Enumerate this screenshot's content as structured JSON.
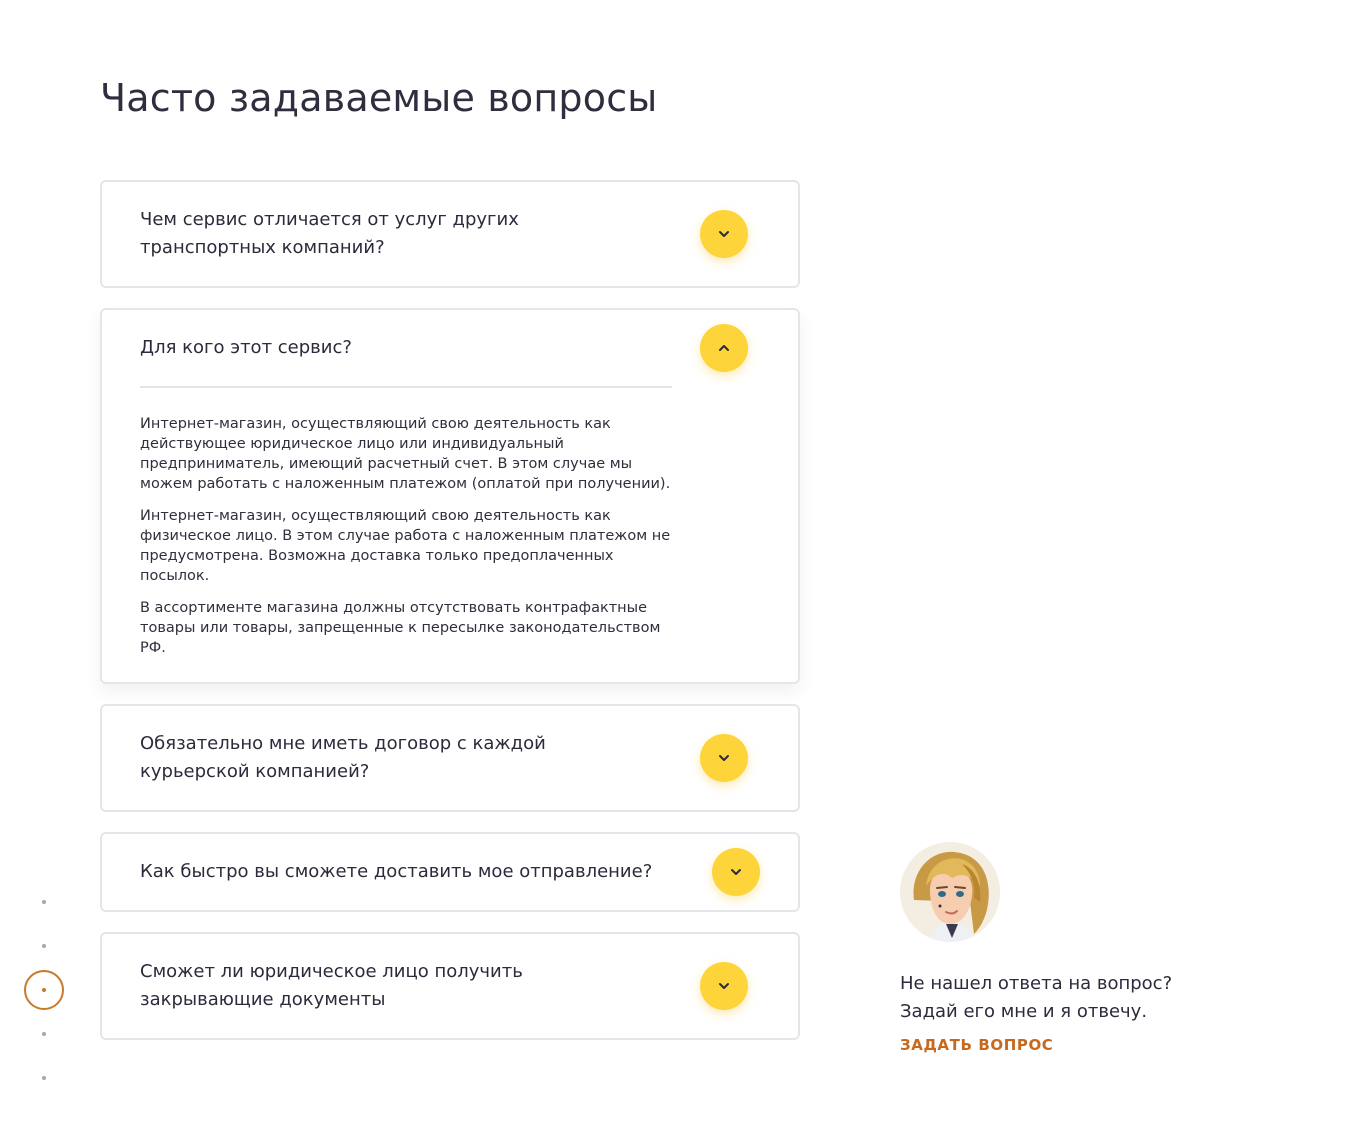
{
  "page": {
    "title": "Часто задаваемые вопросы"
  },
  "faq": {
    "items": [
      {
        "question": "Чем сервис отличается от услуг других транспортных компаний?",
        "expanded": false,
        "icon": "chevron-down-icon"
      },
      {
        "question": "Для кого этот сервис?",
        "expanded": true,
        "icon": "chevron-up-icon",
        "answer": [
          "Интернет-магазин, осуществляющий свою деятельность как действующее юридическое лицо или индивидуальный предприниматель, имеющий расчетный счет. В этом случае мы можем работать с наложенным платежом (оплатой при получении).",
          "Интернет-магазин, осуществляющий свою деятельность как физическое лицо. В этом случае работа с наложенным платежом не предусмотрена. Возможна доставка только предоплаченных посылок.",
          "В ассортименте магазина должны отсутствовать контрафактные товары или товары, запрещенные к пересылке законодательством РФ."
        ]
      },
      {
        "question": "Обязательно мне иметь договор с каждой курьерской компанией?",
        "expanded": false,
        "icon": "chevron-down-icon"
      },
      {
        "question": "Как быстро вы сможете доставить мое отправление?",
        "expanded": false,
        "icon": "chevron-down-icon"
      },
      {
        "question": "Сможет ли юридическое лицо получить закрывающие документы",
        "expanded": false,
        "icon": "chevron-down-icon"
      }
    ]
  },
  "help": {
    "line1": "Не нашел ответа на вопрос?",
    "line2": "Задай его мне и я отвечу.",
    "link_label": "ЗАДАТЬ ВОПРОС"
  },
  "colors": {
    "accent_yellow": "#fdd43a",
    "link_orange": "#c7681d",
    "active_dot": "#c77a2b"
  },
  "dots_nav": {
    "count": 5,
    "active_index": 2
  }
}
